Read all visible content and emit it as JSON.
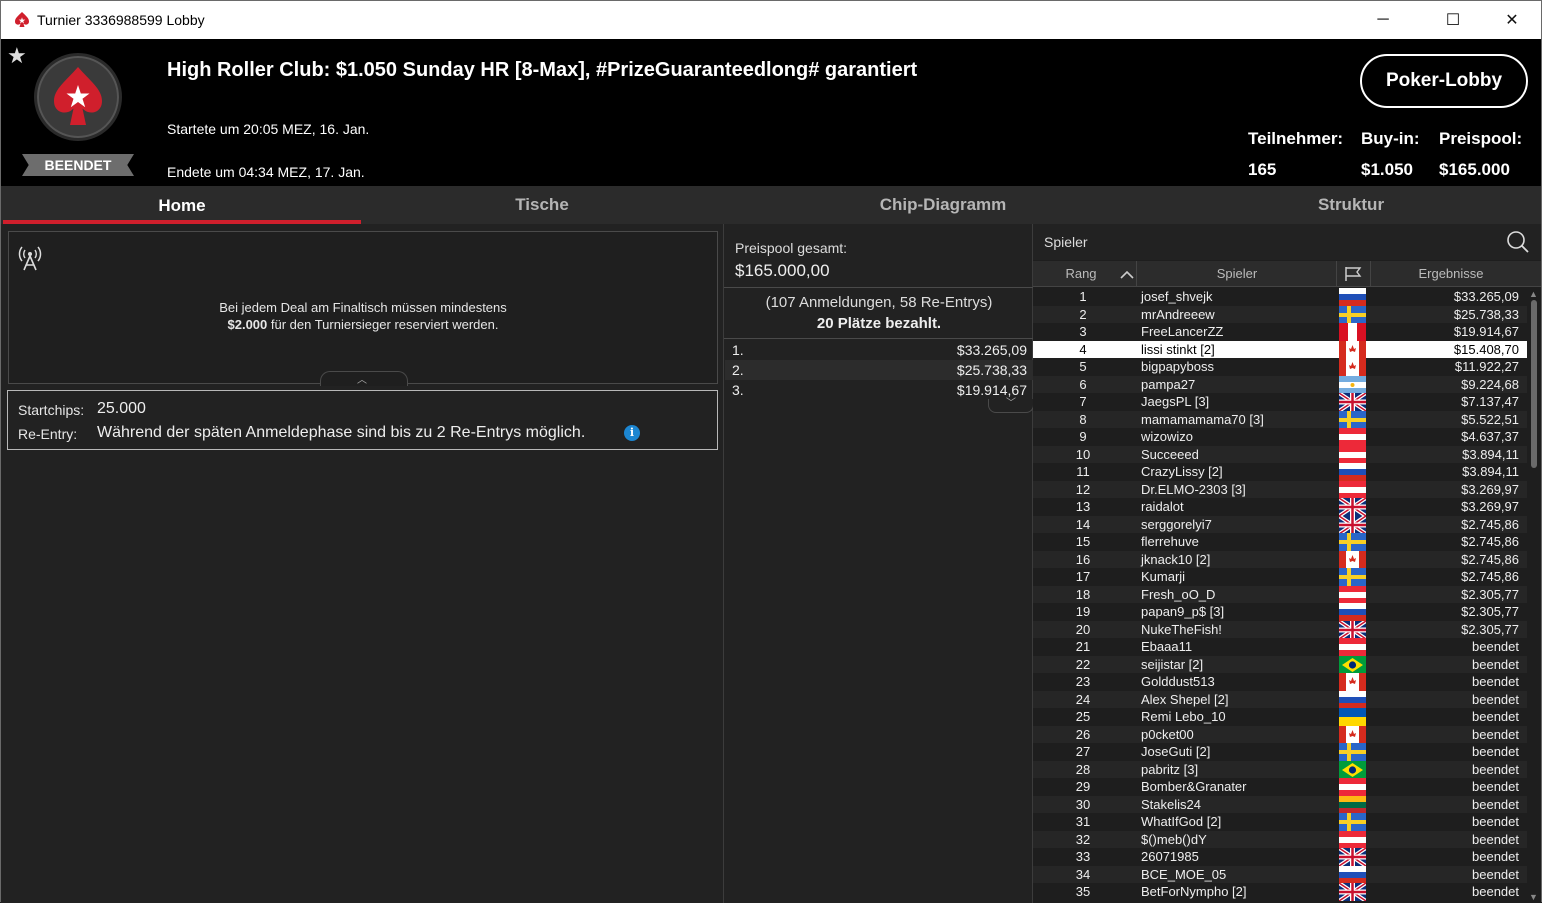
{
  "window": {
    "title": "Turnier 3336988599 Lobby",
    "minimize_glyph": "─",
    "maximize_glyph": "☐",
    "close_glyph": "✕"
  },
  "header": {
    "status": "BEENDET",
    "title": "High Roller Club: $1.050 Sunday HR [8-Max], #PrizeGuaranteedlong# garantiert",
    "started": "Startete um 20:05 MEZ, 16. Jan.",
    "ended": "Endete um 04:34 MEZ, 17. Jan.",
    "lobby_button": "Poker-Lobby",
    "stats": {
      "participants_label": "Teilnehmer:",
      "participants_value": "165",
      "buyin_label": "Buy-in:",
      "buyin_value": "$1.050",
      "prizepool_label": "Preispool:",
      "prizepool_value": "$165.000"
    }
  },
  "tabs": [
    "Home",
    "Tische",
    "Chip-Diagramm",
    "Struktur"
  ],
  "home": {
    "news_line1": "Bei jedem Deal am Finaltisch müssen mindestens",
    "news_line2_bold": "$2.000",
    "news_line2_rest": " für den Turniersieger reserviert werden.",
    "startchips_label": "Startchips:",
    "startchips_value": "25.000",
    "reentry_label": "Re-Entry:",
    "reentry_value": "Während der späten Anmeldephase sind bis zu 2 Re-Entrys möglich.",
    "info_glyph": "i"
  },
  "prize": {
    "total_label": "Preispool gesamt:",
    "total_value": "$165.000,00",
    "entries": "(107 Anmeldungen, 58 Re-Entrys)",
    "paid": "20 Plätze bezahlt.",
    "places": [
      {
        "place": "1.",
        "amount": "$33.265,09"
      },
      {
        "place": "2.",
        "amount": "$25.738,33"
      },
      {
        "place": "3.",
        "amount": "$19.914,67"
      }
    ]
  },
  "players": {
    "search_label": "Spieler",
    "col_rank": "Rang",
    "col_player": "Spieler",
    "col_result": "Ergebnisse",
    "highlight_rank": "4",
    "rows": [
      {
        "rank": "1",
        "name": "josef_shvejk",
        "flag": "ru",
        "result": "$33.265,09"
      },
      {
        "rank": "2",
        "name": "mrAndreeew",
        "flag": "se",
        "result": "$25.738,33"
      },
      {
        "rank": "3",
        "name": "FreeLancerZZ",
        "flag": "pe",
        "result": "$19.914,67"
      },
      {
        "rank": "4",
        "name": "lissi stinkt [2]",
        "flag": "ca",
        "result": "$15.408,70"
      },
      {
        "rank": "5",
        "name": "bigpapyboss",
        "flag": "ca",
        "result": "$11.922,27"
      },
      {
        "rank": "6",
        "name": "pampa27",
        "flag": "ar",
        "result": "$9.224,68"
      },
      {
        "rank": "7",
        "name": "JaegsPL [3]",
        "flag": "gb",
        "result": "$7.137,47"
      },
      {
        "rank": "8",
        "name": "mamamamama70 [3]",
        "flag": "se",
        "result": "$5.522,51"
      },
      {
        "rank": "9",
        "name": "wizowizo",
        "flag": "at",
        "result": "$4.637,37"
      },
      {
        "rank": "10",
        "name": "Succeeed",
        "flag": "at",
        "result": "$3.894,11"
      },
      {
        "rank": "11",
        "name": "CrazyLissy [2]",
        "flag": "ru",
        "result": "$3.894,11"
      },
      {
        "rank": "12",
        "name": "Dr.ELMO-2303 [3]",
        "flag": "at",
        "result": "$3.269,97"
      },
      {
        "rank": "13",
        "name": "raidalot",
        "flag": "gb",
        "result": "$3.269,97"
      },
      {
        "rank": "14",
        "name": "serggorelyi7",
        "flag": "gb",
        "result": "$2.745,86"
      },
      {
        "rank": "15",
        "name": "flerrehuve",
        "flag": "se",
        "result": "$2.745,86"
      },
      {
        "rank": "16",
        "name": "jknack10 [2]",
        "flag": "ca",
        "result": "$2.745,86"
      },
      {
        "rank": "17",
        "name": "Kumarji",
        "flag": "se",
        "result": "$2.745,86"
      },
      {
        "rank": "18",
        "name": "Fresh_oO_D",
        "flag": "at",
        "result": "$2.305,77"
      },
      {
        "rank": "19",
        "name": "papan9_p$ [3]",
        "flag": "ru",
        "result": "$2.305,77"
      },
      {
        "rank": "20",
        "name": "NukeTheFish!",
        "flag": "gb",
        "result": "$2.305,77"
      },
      {
        "rank": "21",
        "name": "Ebaaa11",
        "flag": "at",
        "result": "beendet"
      },
      {
        "rank": "22",
        "name": "seijistar [2]",
        "flag": "br",
        "result": "beendet"
      },
      {
        "rank": "23",
        "name": "Golddust513",
        "flag": "ca",
        "result": "beendet"
      },
      {
        "rank": "24",
        "name": "Alex Shepel [2]",
        "flag": "ru",
        "result": "beendet"
      },
      {
        "rank": "25",
        "name": "Remi Lebo_10",
        "flag": "ua",
        "result": "beendet"
      },
      {
        "rank": "26",
        "name": "p0cket00",
        "flag": "ca",
        "result": "beendet"
      },
      {
        "rank": "27",
        "name": "JoseGuti [2]",
        "flag": "se",
        "result": "beendet"
      },
      {
        "rank": "28",
        "name": "pabritz [3]",
        "flag": "br",
        "result": "beendet"
      },
      {
        "rank": "29",
        "name": "Bomber&Granater",
        "flag": "at",
        "result": "beendet"
      },
      {
        "rank": "30",
        "name": "Stakelis24",
        "flag": "lt",
        "result": "beendet"
      },
      {
        "rank": "31",
        "name": "WhatIfGod [2]",
        "flag": "se",
        "result": "beendet"
      },
      {
        "rank": "32",
        "name": "$()meb()dY",
        "flag": "at",
        "result": "beendet"
      },
      {
        "rank": "33",
        "name": "26071985",
        "flag": "gb",
        "result": "beendet"
      },
      {
        "rank": "34",
        "name": "BCE_MOE_05",
        "flag": "ru",
        "result": "beendet"
      },
      {
        "rank": "35",
        "name": "BetForNympho [2]",
        "flag": "gb",
        "result": "beendet"
      }
    ]
  },
  "colors": {
    "accent": "#d01f2c",
    "info": "#1c86d1"
  }
}
